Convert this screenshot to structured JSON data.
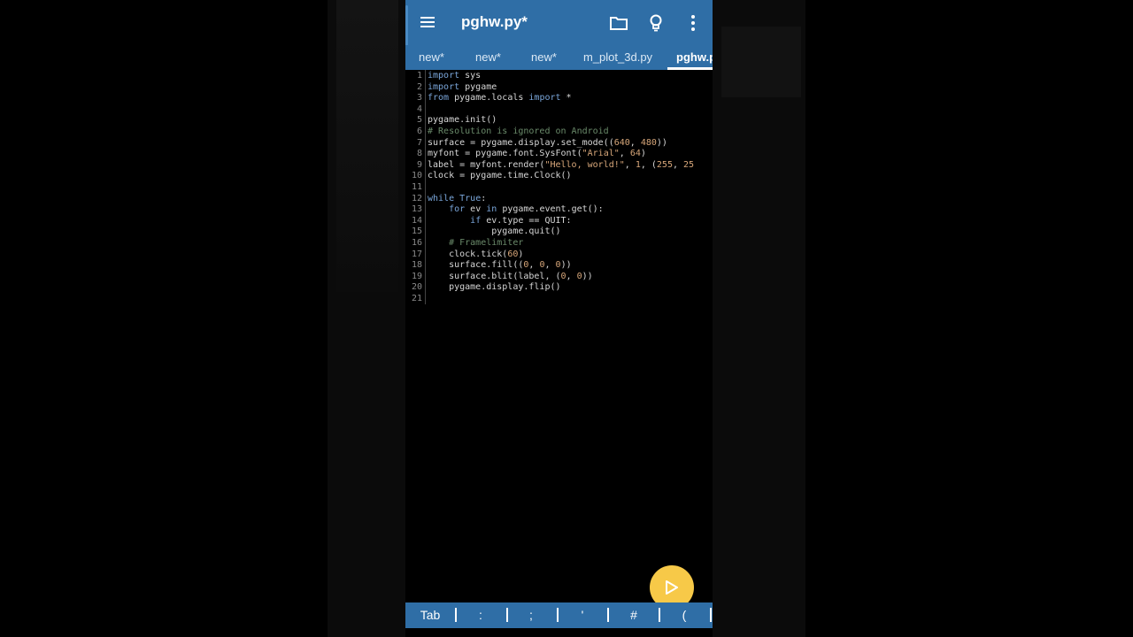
{
  "app": {
    "title": "pghw.py*"
  },
  "toolbar": {
    "icons": [
      "menu-icon",
      "folder-icon",
      "lightbulb-icon",
      "more-vert-icon"
    ]
  },
  "tabs": [
    {
      "label": "new*"
    },
    {
      "label": "new*"
    },
    {
      "label": "new*"
    },
    {
      "label": "m_plot_3d.py"
    },
    {
      "label": "pghw.py",
      "active": true
    }
  ],
  "editor": {
    "lines": [
      {
        "n": "1",
        "code": "import sys"
      },
      {
        "n": "2",
        "code": "import pygame"
      },
      {
        "n": "3",
        "code": "from pygame.locals import *"
      },
      {
        "n": "4",
        "code": ""
      },
      {
        "n": "5",
        "code": "pygame.init()"
      },
      {
        "n": "6",
        "code": "# Resolution is ignored on Android"
      },
      {
        "n": "7",
        "code": "surface = pygame.display.set_mode((640, 480))"
      },
      {
        "n": "8",
        "code": "myfont = pygame.font.SysFont(\"Arial\", 64)"
      },
      {
        "n": "9",
        "code": "label = myfont.render(\"Hello, world!\", 1, (255, 25"
      },
      {
        "n": "10",
        "code": "clock = pygame.time.Clock()"
      },
      {
        "n": "11",
        "code": ""
      },
      {
        "n": "12",
        "code": "while True:"
      },
      {
        "n": "13",
        "code": "    for ev in pygame.event.get():"
      },
      {
        "n": "14",
        "code": "        if ev.type == QUIT:"
      },
      {
        "n": "15",
        "code": "            pygame.quit()"
      },
      {
        "n": "16",
        "code": "    # Framelimiter"
      },
      {
        "n": "17",
        "code": "    clock.tick(60)"
      },
      {
        "n": "18",
        "code": "    surface.fill((0, 0, 0))"
      },
      {
        "n": "19",
        "code": "    surface.blit(label, (0, 0))"
      },
      {
        "n": "20",
        "code": "    pygame.display.flip()"
      },
      {
        "n": "21",
        "code": ""
      }
    ]
  },
  "run_button": {
    "icon": "play-icon"
  },
  "keybar": {
    "keys": [
      "Tab",
      ":",
      ";",
      "'",
      "#",
      "("
    ]
  },
  "colors": {
    "accent": "#2f6ea6",
    "fab": "#f7c948",
    "background": "#000000"
  }
}
